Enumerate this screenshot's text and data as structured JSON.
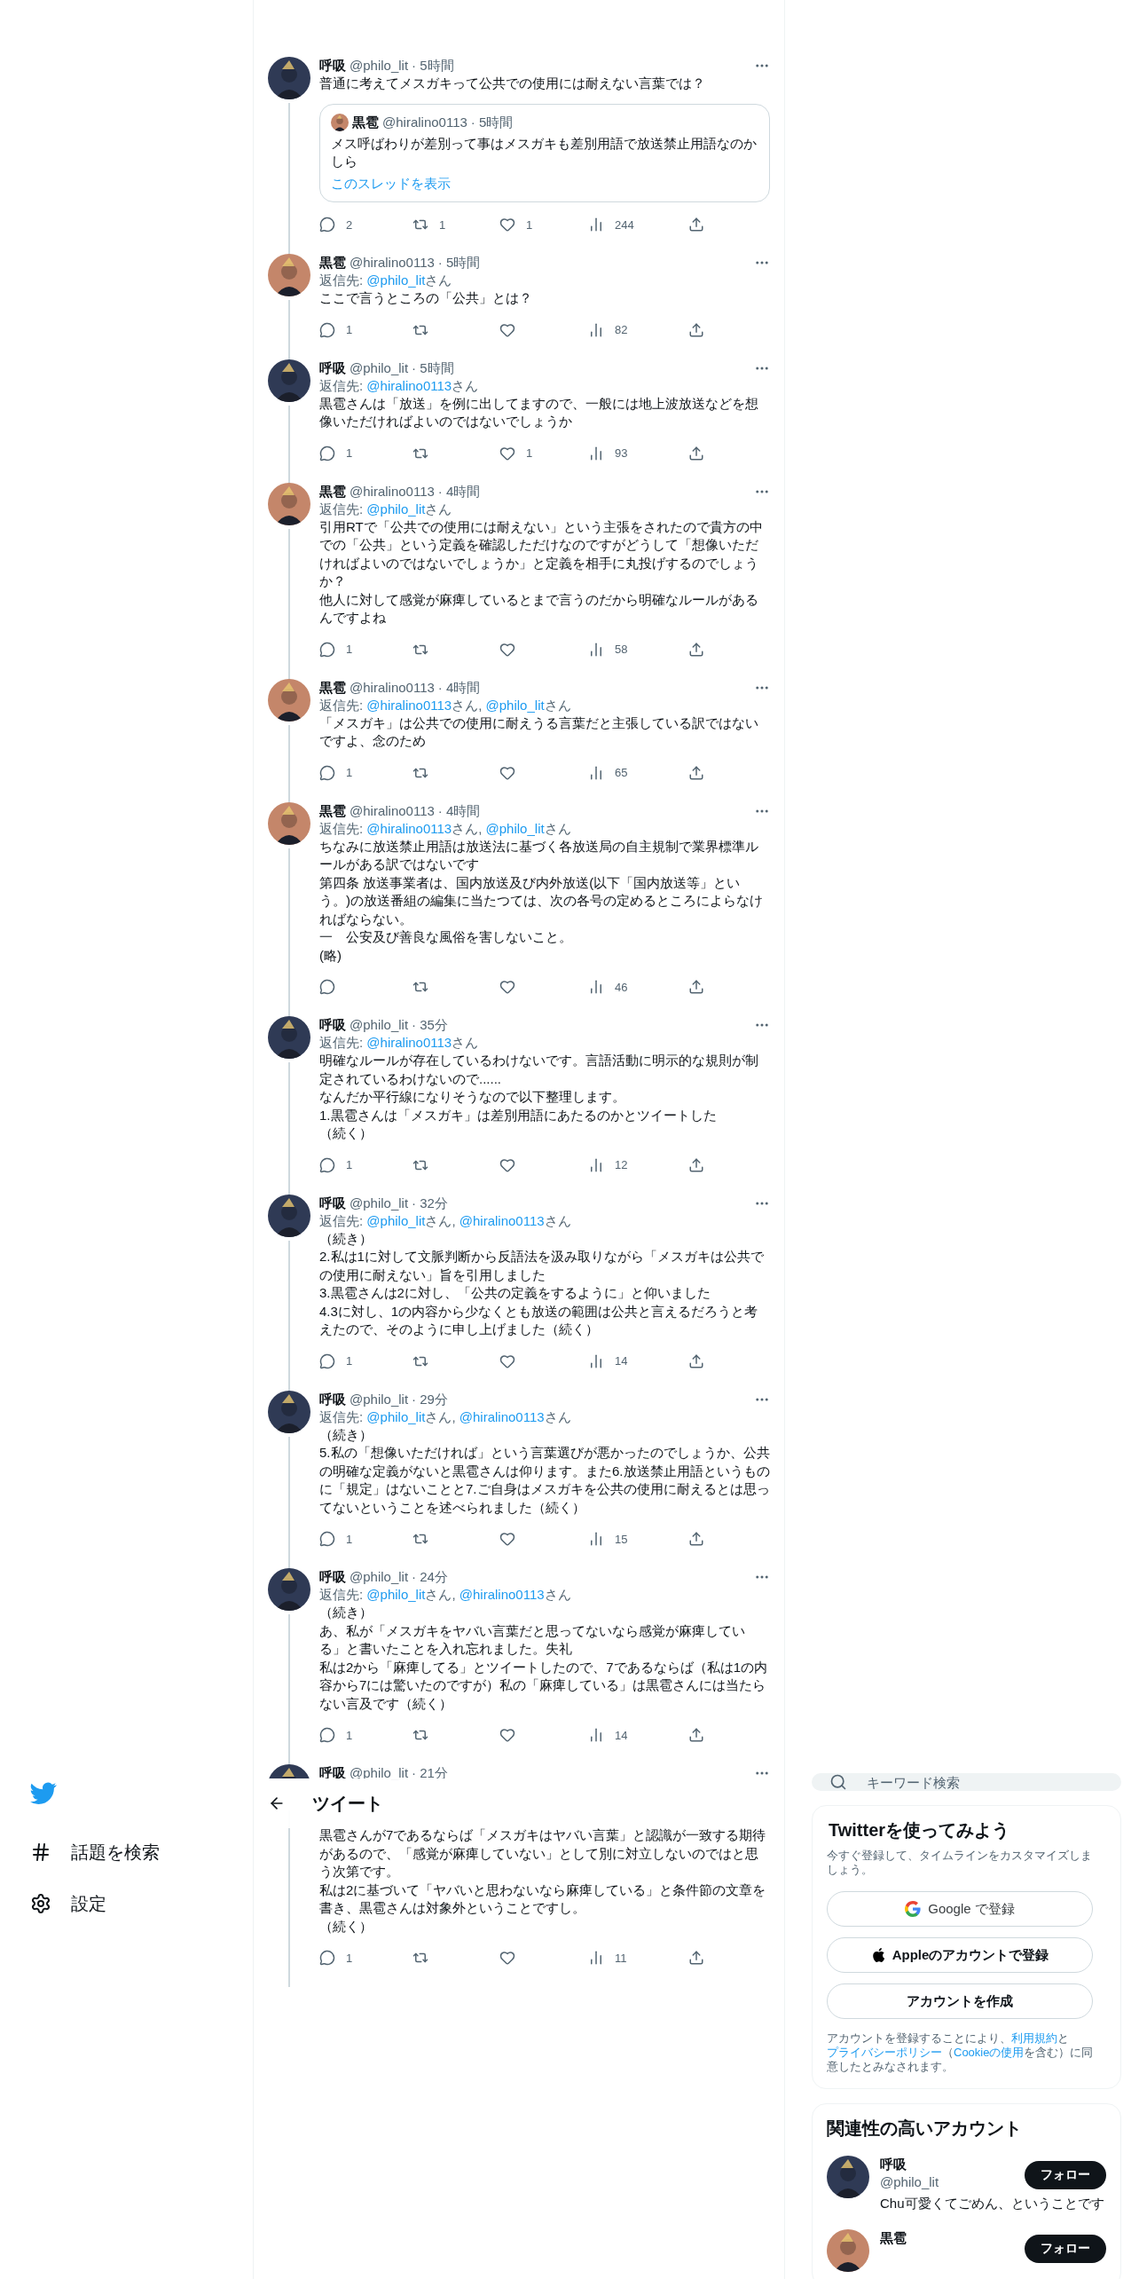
{
  "nav": {
    "items": [
      {
        "kind": "explore",
        "label": "話題を検索"
      },
      {
        "kind": "settings",
        "label": "設定"
      }
    ]
  },
  "header": {
    "title": "ツイート"
  },
  "tweets": [
    {
      "name": "呼吸",
      "handle": "@philo_lit",
      "time": "· 5時間",
      "text": [
        "普通に考えてメスガキって公共での使用には耐えない言葉では？"
      ],
      "quote": {
        "name": "黒雹",
        "handle": "@hiralino0113",
        "time": "· 5時間",
        "text": "メス呼ばわりが差別って事はメスガキも差別用語で放送禁止用語なのかしら",
        "link": "このスレッドを表示"
      },
      "replies": "2",
      "retweets": "1",
      "likes": "1",
      "views": "244"
    },
    {
      "name": "黒雹",
      "handle": "@hiralino0113",
      "time": "· 5時間",
      "reply_to": {
        "label": "返信先:",
        "mentions": [
          {
            "handle": "@philo_lit",
            "suffix": "さん"
          }
        ]
      },
      "text": [
        "ここで言うところの「公共」とは？"
      ],
      "replies": "1",
      "views": "82"
    },
    {
      "name": "呼吸",
      "handle": "@philo_lit",
      "time": "· 5時間",
      "reply_to": {
        "label": "返信先:",
        "mentions": [
          {
            "handle": "@hiralino0113",
            "suffix": "さん"
          }
        ]
      },
      "text": [
        "黒雹さんは「放送」を例に出してますので、一般には地上波放送などを想像いただければよいのではないでしょうか"
      ],
      "replies": "1",
      "likes": "1",
      "views": "93"
    },
    {
      "name": "黒雹",
      "handle": "@hiralino0113",
      "time": "· 4時間",
      "reply_to": {
        "label": "返信先:",
        "mentions": [
          {
            "handle": "@philo_lit",
            "suffix": "さん"
          }
        ]
      },
      "text": [
        "引用RTで「公共での使用には耐えない」という主張をされたので貴方の中での「公共」という定義を確認しただけなのですがどうして「想像いただければよいのではないでしょうか」と定義を相手に丸投げするのでしょうか？",
        "他人に対して感覚が麻痺しているとまで言うのだから明確なルールがあるんですよね"
      ],
      "replies": "1",
      "views": "58"
    },
    {
      "name": "黒雹",
      "handle": "@hiralino0113",
      "time": "· 4時間",
      "reply_to": {
        "label": "返信先:",
        "mentions": [
          {
            "handle": "@hiralino0113",
            "suffix": "さん, "
          },
          {
            "handle": "@philo_lit",
            "suffix": "さん"
          }
        ]
      },
      "text": [
        "「メスガキ」は公共での使用に耐えうる言葉だと主張している訳ではないですよ、念のため"
      ],
      "replies": "1",
      "views": "65"
    },
    {
      "name": "黒雹",
      "handle": "@hiralino0113",
      "time": "· 4時間",
      "reply_to": {
        "label": "返信先:",
        "mentions": [
          {
            "handle": "@hiralino0113",
            "suffix": "さん, "
          },
          {
            "handle": "@philo_lit",
            "suffix": "さん"
          }
        ]
      },
      "text": [
        "ちなみに放送禁止用語は放送法に基づく各放送局の自主規制で業界標準ルールがある訳ではないです",
        "第四条 放送事業者は、国内放送及び内外放送(以下「国内放送等」という。)の放送番組の編集に当たつては、次の各号の定めるところによらなければならない。",
        "一　公安及び善良な風俗を害しないこと。",
        "(略)"
      ],
      "views": "46"
    },
    {
      "name": "呼吸",
      "handle": "@philo_lit",
      "time": "· 35分",
      "reply_to": {
        "label": "返信先:",
        "mentions": [
          {
            "handle": "@hiralino0113",
            "suffix": "さん"
          }
        ]
      },
      "text": [
        "明確なルールが存在しているわけないです。言語活動に明示的な規則が制定されているわけないので......",
        "なんだか平行線になりそうなので以下整理します。",
        "1.黒雹さんは「メスガキ」は差別用語にあたるのかとツイートした",
        "（続く）"
      ],
      "replies": "1",
      "views": "12"
    },
    {
      "name": "呼吸",
      "handle": "@philo_lit",
      "time": "· 32分",
      "reply_to": {
        "label": "返信先:",
        "mentions": [
          {
            "handle": "@philo_lit",
            "suffix": "さん, "
          },
          {
            "handle": "@hiralino0113",
            "suffix": "さん"
          }
        ]
      },
      "text": [
        "（続き）",
        "2.私は1に対して文脈判断から反語法を汲み取りながら「メスガキは公共での使用に耐えない」旨を引用しました",
        "3.黒雹さんは2に対し、「公共の定義をするように」と仰いました",
        "4.3に対し、1の内容から少なくとも放送の範囲は公共と言えるだろうと考えたので、そのように申し上げました（続く）"
      ],
      "replies": "1",
      "views": "14"
    },
    {
      "name": "呼吸",
      "handle": "@philo_lit",
      "time": "· 29分",
      "reply_to": {
        "label": "返信先:",
        "mentions": [
          {
            "handle": "@philo_lit",
            "suffix": "さん, "
          },
          {
            "handle": "@hiralino0113",
            "suffix": "さん"
          }
        ]
      },
      "text": [
        "（続き）",
        "5.私の「想像いただければ」という言葉選びが悪かったのでしょうか、公共の明確な定義がないと黒雹さんは仰ります。また6.放送禁止用語というものに「規定」はないことと7.ご自身はメスガキを公共の使用に耐えるとは思ってないということを述べられました（続く）"
      ],
      "replies": "1",
      "views": "15"
    },
    {
      "name": "呼吸",
      "handle": "@philo_lit",
      "time": "· 24分",
      "reply_to": {
        "label": "返信先:",
        "mentions": [
          {
            "handle": "@philo_lit",
            "suffix": "さん, "
          },
          {
            "handle": "@hiralino0113",
            "suffix": "さん"
          }
        ]
      },
      "text": [
        "（続き）",
        "あ、私が「メスガキをヤバい言葉だと思ってないなら感覚が麻痺している」と書いたことを入れ忘れました。失礼",
        "私は2から「麻痺してる」とツイートしたので、7であるならば（私は1の内容から7には驚いたのですが）私の「麻痺している」は黒雹さんには当たらない言及です（続く）"
      ],
      "replies": "1",
      "views": "14"
    },
    {
      "name": "呼吸",
      "handle": "@philo_lit",
      "time": "· 21分",
      "text": [
        "黒雹さんが7であるならば「メスガキはヤバい言葉」と認識が一致する期待があるので、「感覚が麻痺していない」として別に対立しないのではと思う次第です。",
        "私は2に基づいて「ヤバいと思わないなら麻痺している」と条件節の文章を書き、黒雹さんは対象外ということですし。",
        "（続く）"
      ],
      "replies": "1",
      "views": "11"
    }
  ],
  "sidebar": {
    "search": {
      "placeholder": "キーワード検索"
    },
    "signup": {
      "title": "Twitterを使ってみよう",
      "subtitle": "今すぐ登録して、タイムラインをカスタマイズしましょう。",
      "buttons": [
        {
          "kind": "google",
          "label": "Google で登録"
        },
        {
          "kind": "apple",
          "label": "Appleのアカウントで登録"
        },
        {
          "kind": "create",
          "label": "アカウントを作成"
        }
      ],
      "legal": [
        {
          "text": "アカウントを登録することにより、",
          "link": false
        },
        {
          "text": "利用規約",
          "link": true
        },
        {
          "text": "と",
          "link": false
        },
        {
          "text": "プライバシーポリシー",
          "link": true
        },
        {
          "text": "（",
          "link": false
        },
        {
          "text": "Cookieの使用",
          "link": true
        },
        {
          "text": "を含む）に同意したとみなされます。",
          "link": false
        }
      ]
    },
    "related": {
      "title": "関連性の高いアカウント",
      "accounts": [
        {
          "name": "呼吸",
          "handle": "@philo_lit",
          "bio": "Chu可愛くてごめん、ということです",
          "follow": "フォロー"
        },
        {
          "name": "黒雹",
          "follow": "フォロー"
        }
      ]
    }
  }
}
